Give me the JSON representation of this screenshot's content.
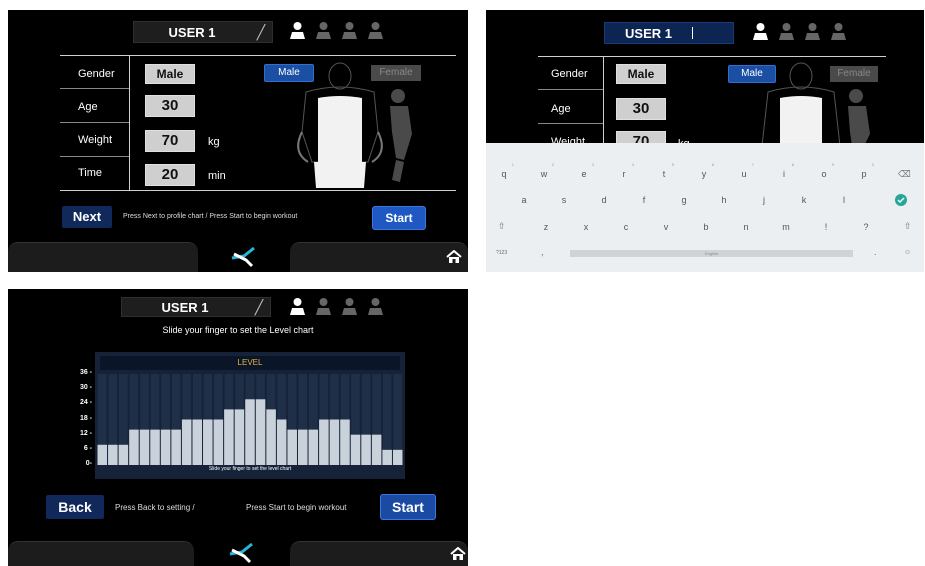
{
  "panel1": {
    "user_name": "USER 1",
    "rows": [
      {
        "label": "Gender",
        "value": "Male",
        "unit": ""
      },
      {
        "label": "Age",
        "value": "30",
        "unit": ""
      },
      {
        "label": "Weight",
        "value": "70",
        "unit": "kg"
      },
      {
        "label": "Time",
        "value": "20",
        "unit": "min"
      }
    ],
    "gender_male": "Male",
    "gender_female": "Female",
    "next_label": "Next",
    "hint": "Press Next to profile chart /   Press Start to begin workout",
    "start_label": "Start"
  },
  "panel2": {
    "user_name": "USER 1",
    "rows": [
      {
        "label": "Gender",
        "value": "Male",
        "unit": ""
      },
      {
        "label": "Age",
        "value": "30",
        "unit": ""
      },
      {
        "label": "Weight",
        "value": "70",
        "unit": "kg"
      }
    ],
    "gender_male": "Male",
    "gender_female": "Female",
    "keyboard": {
      "row1": [
        "q",
        "w",
        "e",
        "r",
        "t",
        "y",
        "u",
        "i",
        "o",
        "p"
      ],
      "row1_sup": [
        "1",
        "2",
        "3",
        "4",
        "5",
        "6",
        "7",
        "8",
        "9",
        "0"
      ],
      "row2": [
        "a",
        "s",
        "d",
        "f",
        "g",
        "h",
        "j",
        "k",
        "l"
      ],
      "row3": [
        "z",
        "x",
        "c",
        "v",
        "b",
        "n",
        "m",
        "!",
        "?"
      ],
      "mode_key": "?123",
      "comma": ",",
      "period": ".",
      "space_label": "English"
    }
  },
  "panel3": {
    "user_name": "USER 1",
    "instruction": "Slide your finger to set the Level chart",
    "chart_hint": "Slide your finger to set the level chart",
    "back_label": "Back",
    "hint_left": "Press Back to setting /",
    "hint_right": "Press Start to begin workout",
    "start_label": "Start"
  },
  "chart_data": {
    "type": "bar",
    "title": "LEVEL",
    "yticks": [
      36,
      30,
      24,
      18,
      12,
      6,
      0
    ],
    "ylim": [
      0,
      36
    ],
    "values": [
      8,
      8,
      8,
      14,
      14,
      14,
      14,
      14,
      18,
      18,
      18,
      18,
      22,
      22,
      26,
      26,
      22,
      18,
      14,
      14,
      14,
      18,
      18,
      18,
      12,
      12,
      12,
      6,
      6
    ],
    "bar_color": "#c9d2da",
    "background_color": "#152238",
    "title_color": "#e2b642"
  },
  "colors": {
    "accent_blue": "#1f58c2",
    "navy_button": "#10295a",
    "value_box": "#cfcfcf",
    "logo_cyan": "#27b6d6"
  }
}
